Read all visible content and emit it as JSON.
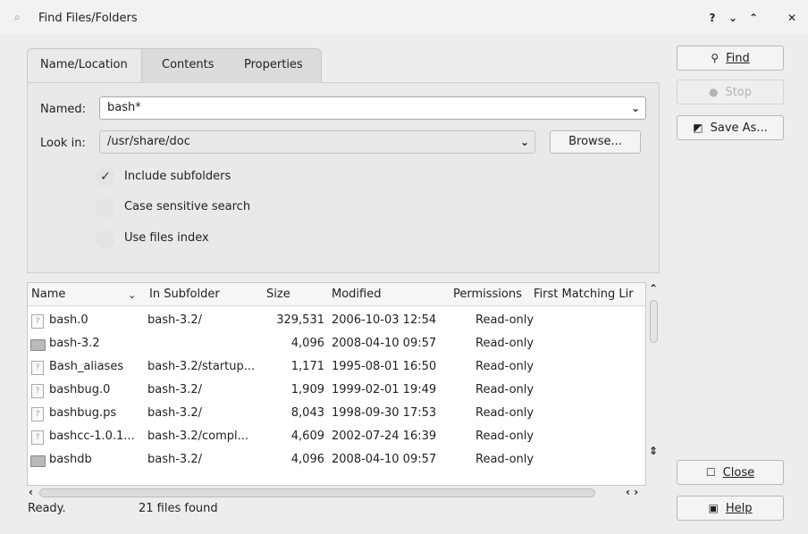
{
  "window": {
    "title": "Find Files/Folders",
    "controls": {
      "help": "?",
      "minimize": "⌄",
      "maximize": "⌃",
      "close": "✕"
    }
  },
  "tabs": [
    {
      "label": "Name/Location",
      "active": true
    },
    {
      "label": "Contents",
      "active": false
    },
    {
      "label": "Properties",
      "active": false
    }
  ],
  "form": {
    "named_label": "Named:",
    "named_value": "bash*",
    "lookin_label": "Look in:",
    "lookin_value": "/usr/share/doc",
    "browse_label": "Browse...",
    "options": [
      {
        "label": "Include subfolders",
        "checked": true
      },
      {
        "label": "Case sensitive search",
        "checked": false
      },
      {
        "label": "Use files index",
        "checked": false
      }
    ]
  },
  "results": {
    "columns": [
      "Name",
      "In Subfolder",
      "Size",
      "Modified",
      "Permissions",
      "First Matching Lir"
    ],
    "rows": [
      {
        "icon": "file-icon",
        "name": "bash.0",
        "subfolder": "bash-3.2/",
        "size": "329,531",
        "modified": "2006-10-03 12:54",
        "permissions": "Read-only",
        "match": ""
      },
      {
        "icon": "folder-icon",
        "name": "bash-3.2",
        "subfolder": "",
        "size": "4,096",
        "modified": "2008-04-10 09:57",
        "permissions": "Read-only",
        "match": ""
      },
      {
        "icon": "file-icon",
        "name": "Bash_aliases",
        "subfolder": "bash-3.2/startup...",
        "size": "1,171",
        "modified": "1995-08-01 16:50",
        "permissions": "Read-only",
        "match": ""
      },
      {
        "icon": "file-icon",
        "name": "bashbug.0",
        "subfolder": "bash-3.2/",
        "size": "1,909",
        "modified": "1999-02-01 19:49",
        "permissions": "Read-only",
        "match": ""
      },
      {
        "icon": "file-icon",
        "name": "bashbug.ps",
        "subfolder": "bash-3.2/",
        "size": "8,043",
        "modified": "1998-09-30 17:53",
        "permissions": "Read-only",
        "match": ""
      },
      {
        "icon": "file-icon",
        "name": "bashcc-1.0.1...",
        "subfolder": "bash-3.2/compl...",
        "size": "4,609",
        "modified": "2002-07-24 16:39",
        "permissions": "Read-only",
        "match": ""
      },
      {
        "icon": "folder-icon",
        "name": "bashdb",
        "subfolder": "bash-3.2/",
        "size": "4,096",
        "modified": "2008-04-10 09:57",
        "permissions": "Read-only",
        "match": ""
      }
    ]
  },
  "status": {
    "state": "Ready.",
    "count": "21 files found"
  },
  "buttons": {
    "find": "Find",
    "stop": "Stop",
    "save_as": "Save As...",
    "close": "Close",
    "help": "Help"
  },
  "colors": {
    "window_bg": "#ededed",
    "panel_bg": "#e9e9e9",
    "accent": "#222222"
  }
}
